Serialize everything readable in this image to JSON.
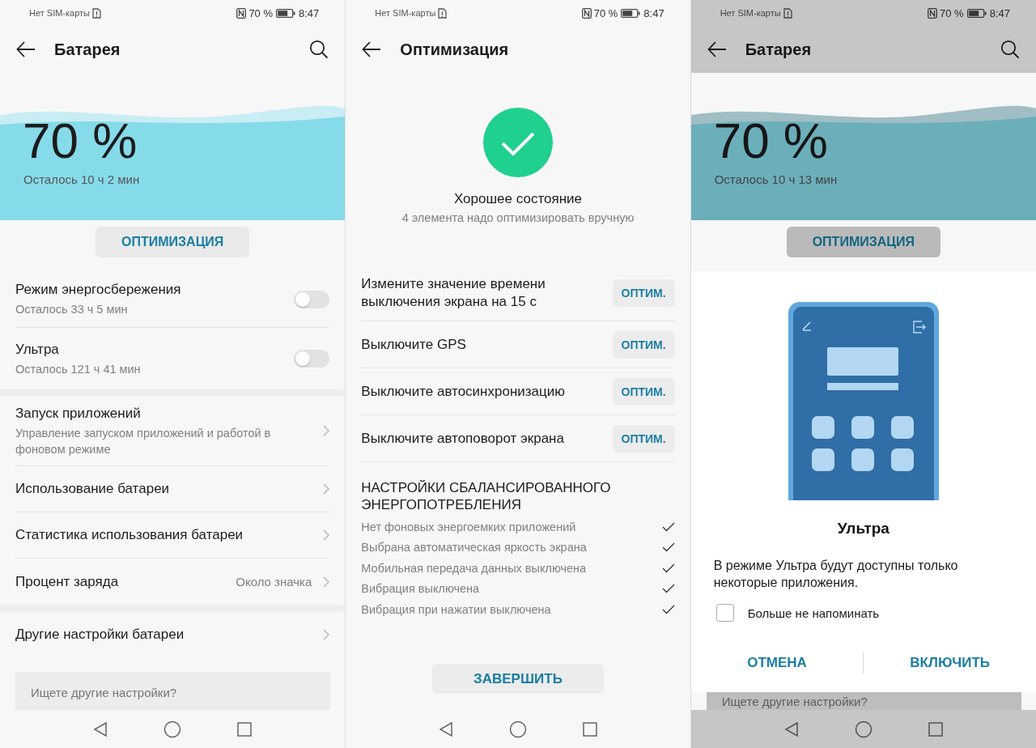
{
  "screens": [
    {
      "kind": "battery",
      "dimmed": false,
      "status": {
        "carrier": "Нет SIM-карты",
        "battery": "70 %",
        "time": "8:47"
      },
      "title": "Батарея",
      "percent": "70 %",
      "remaining": "Осталось 10 ч 2 мин",
      "optimize_button": "ОПТИМИЗАЦИЯ",
      "sections": [
        {
          "items": [
            {
              "kind": "toggle",
              "title": "Режим энергосбережения",
              "subtitle": "Осталось 33 ч 5 мин",
              "on": false
            },
            {
              "kind": "toggle",
              "title": "Ультра",
              "subtitle": "Осталось 121 ч 41 мин",
              "on": false
            }
          ]
        },
        {
          "items": [
            {
              "kind": "link",
              "title": "Запуск приложений",
              "subtitle": "Управление запуском приложений и работой в фоновом режиме"
            },
            {
              "kind": "link",
              "title": "Использование батареи"
            },
            {
              "kind": "link",
              "title": "Статистика использования батареи"
            },
            {
              "kind": "link",
              "title": "Процент заряда",
              "value": "Около значка"
            }
          ]
        },
        {
          "items": [
            {
              "kind": "link",
              "title": "Другие настройки батареи"
            }
          ]
        }
      ],
      "search": {
        "placeholder": "Ищете другие настройки?"
      }
    },
    {
      "kind": "optimization",
      "status": {
        "carrier": "Нет SIM-карты",
        "battery": "70 %",
        "time": "8:47"
      },
      "title": "Оптимизация",
      "state_title": "Хорошее состояние",
      "state_subtitle": "4 элемента надо оптимизировать вручную",
      "tasks": [
        {
          "label": "Измените значение времени выключения экрана на 15 с",
          "button": "ОПТИМ."
        },
        {
          "label": "Выключите GPS",
          "button": "ОПТИМ."
        },
        {
          "label": "Выключите автосинхронизацию",
          "button": "ОПТИМ."
        },
        {
          "label": "Выключите автоповорот экрана",
          "button": "ОПТИМ."
        }
      ],
      "balanced": {
        "heading": "НАСТРОЙКИ СБАЛАНСИРОВАННОГО ЭНЕРГОПОТРЕБЛЕНИЯ",
        "items": [
          {
            "label": "Нет фоновых энергоемких приложений",
            "checked": true
          },
          {
            "label": "Выбрана автоматическая яркость экрана",
            "checked": true
          },
          {
            "label": "Мобильная передача данных выключена",
            "checked": true
          },
          {
            "label": "Вибрация выключена",
            "checked": true
          },
          {
            "label": "Вибрация при нажатии выключена",
            "checked": true
          }
        ]
      },
      "finish_button": "ЗАВЕРШИТЬ"
    },
    {
      "kind": "battery",
      "dimmed": true,
      "status": {
        "carrier": "Нет SIM-карты",
        "battery": "70 %",
        "time": "8:47"
      },
      "title": "Батарея",
      "percent": "70 %",
      "remaining": "Осталось 10 ч 13 мин",
      "optimize_button": "ОПТИМИЗАЦИЯ",
      "dialog": {
        "title": "Ультра",
        "message": "В режиме Ультра будут доступны только некоторые приложения.",
        "checkbox": {
          "label": "Больше не напоминать",
          "checked": false
        },
        "buttons": [
          "ОТМЕНА",
          "ВКЛЮЧИТЬ"
        ]
      },
      "search": {
        "placeholder": "Ищете другие настройки?"
      }
    }
  ]
}
